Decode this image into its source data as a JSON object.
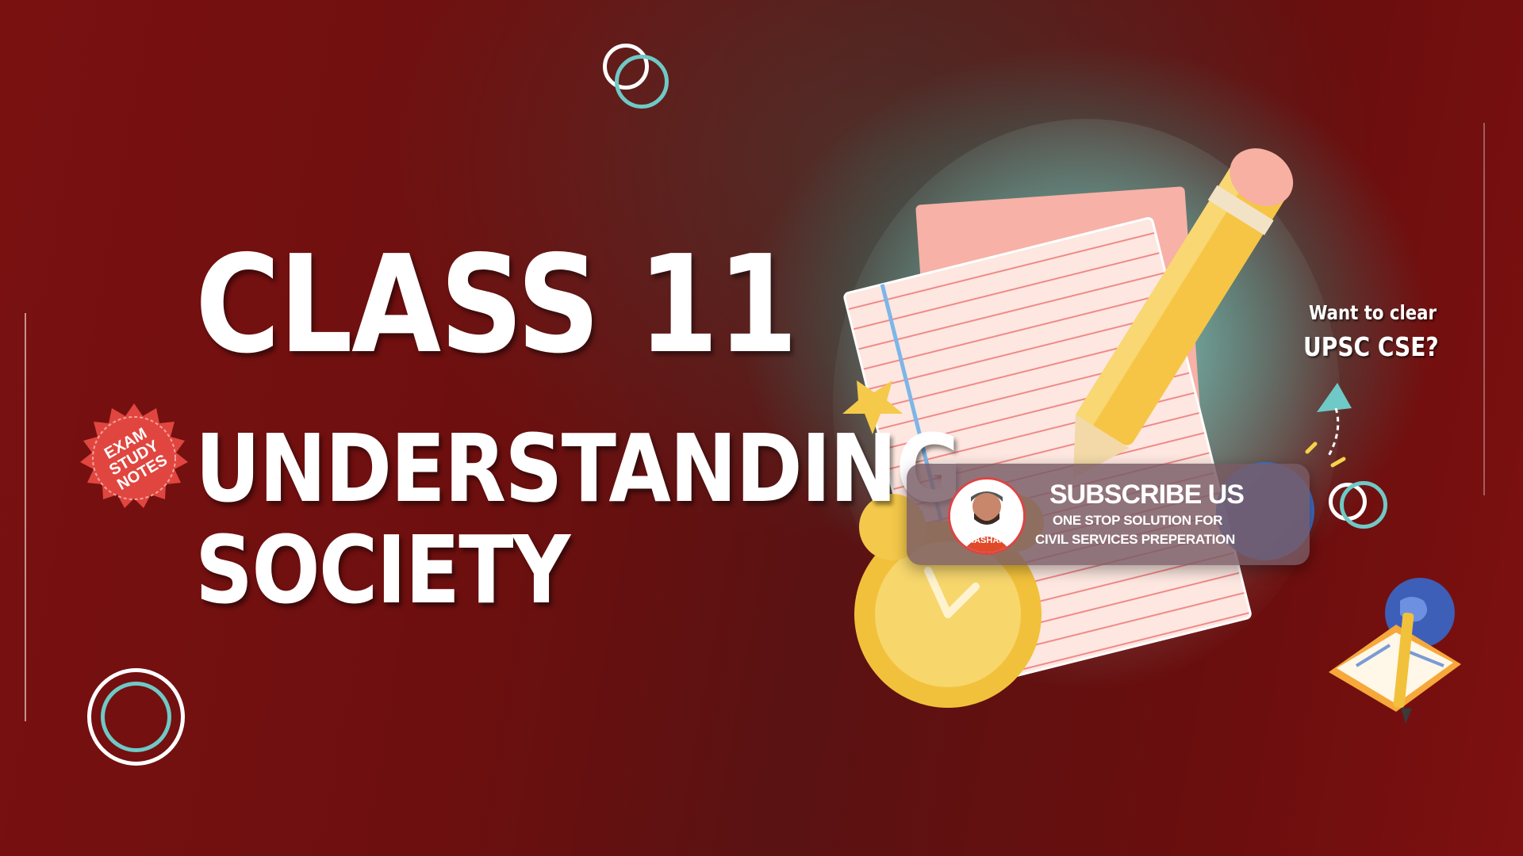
{
  "headline": {
    "line1": "CLASS 11",
    "line2": "UNDERSTANDING",
    "line3": "SOCIETY"
  },
  "badge": {
    "line1": "EXAM",
    "line2": "STUDY",
    "line3": "NOTES",
    "color": "#e0463f"
  },
  "subscribe": {
    "title": "SUBSCRIBE US",
    "line1": "ONE STOP SOLUTION FOR",
    "line2": "CIVIL SERVICES PREPERATION",
    "avatar_text": "SHASHANK"
  },
  "promo": {
    "line1": "Want to clear",
    "line2": "UPSC CSE?"
  },
  "colors": {
    "background": "#6d0f0f",
    "teal_accent": "#6fc9c6",
    "text": "#ffffff"
  },
  "icons": [
    "rings-icon",
    "notebook-icon",
    "pencil-icon",
    "alarm-clock-icon",
    "globe-book-icon",
    "arrow-icon",
    "star-icon"
  ]
}
